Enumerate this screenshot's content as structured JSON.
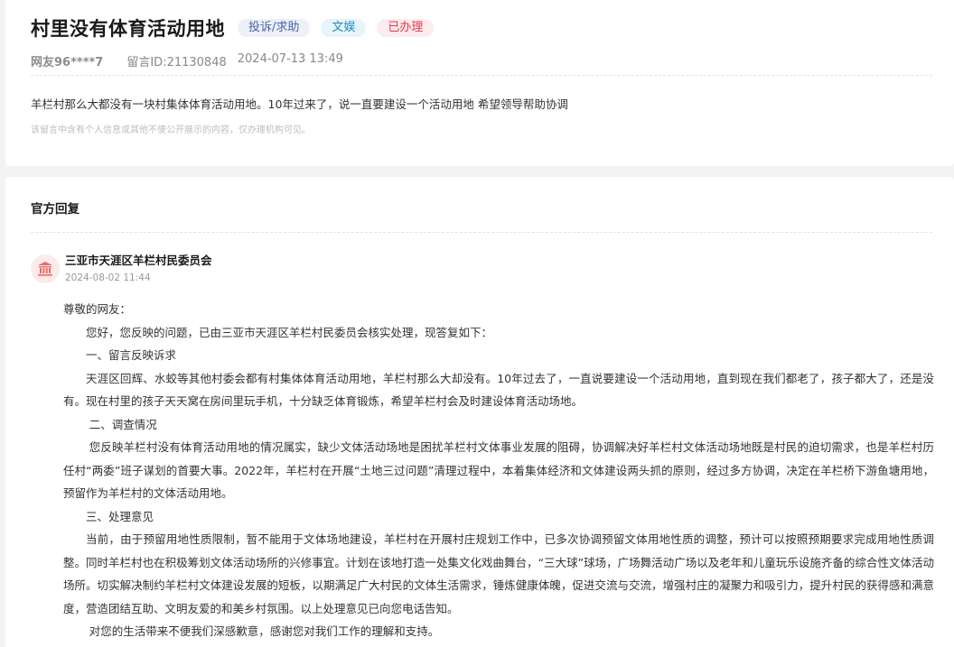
{
  "post": {
    "title": "村里没有体育活动用地",
    "tags": {
      "category": "投诉/求助",
      "area": "文娱",
      "status": "已办理"
    },
    "author": "网友96****7",
    "message_id": "留言ID:21130848",
    "datetime": "2024-07-13 13:49",
    "content": "羊栏村那么大都没有一块村集体体育活动用地。10年过来了，说一直要建设一个活动用地 希望领导帮助协调",
    "privacy_notice": "该留言中含有个人信息或其他不便公开展示的内容，仅办理机构可见。"
  },
  "reply": {
    "section_title": "官方回复",
    "org_name": "三亚市天涯区羊栏村民委员会",
    "org_time": "2024-08-02 11:44",
    "paragraphs": {
      "greeting": "尊敬的网友：",
      "intro": "您好，您反映的问题，已由三亚市天涯区羊栏村民委员会核实处理，现答复如下：",
      "h1": "一、留言反映诉求",
      "p1": "天涯区回辉、水蛟等其他村委会都有村集体体育活动用地，羊栏村那么大却没有。10年过去了，一直说要建设一个活动用地，直到现在我们都老了，孩子都大了，还是没有。现在村里的孩子天天窝在房间里玩手机，十分缺乏体育锻炼，希望羊栏村会及时建设体育活动场地。",
      "h2": "二、调查情况",
      "p2": "您反映羊栏村没有体育活动用地的情况属实，缺少文体活动场地是困扰羊栏村文体事业发展的阻碍，协调解决好羊栏村文体活动场地既是村民的迫切需求，也是羊栏村历任村“两委”班子谋划的首要大事。2022年，羊栏村在开展“土地三过问题”清理过程中，本着集体经济和文体建设两头抓的原则，经过多方协调，决定在羊栏桥下游鱼塘用地，预留作为羊栏村的文体活动用地。",
      "h3": "三、处理意见",
      "p3": "当前，由于预留用地性质限制，暂不能用于文体场地建设，羊栏村在开展村庄规划工作中，已多次协调预留文体用地性质的调整，预计可以按照预期要求完成用地性质调整。同时羊栏村也在积极筹划文体活动场所的兴修事宜。计划在该地打造一处集文化戏曲舞台，“三大球”球场，广场舞活动广场以及老年和儿童玩乐设施齐备的综合性文体活动场所。切实解决制约羊栏村文体建设发展的短板，以期满足广大村民的文体生活需求，锤炼健康体魄，促进交流与交流，增强村庄的凝聚力和吸引力，提升村民的获得感和满意度，营造团结互助、文明友爱的和美乡村氛围。以上处理意见已向您电话告知。",
      "closing": "对您的生活带来不便我们深感歉意，感谢您对我们工作的理解和支持。"
    }
  },
  "colors": {
    "status_red": "#e0394a",
    "category_blue": "#4a63a6",
    "area_cyan": "#1f8bbd",
    "org_icon": "#e86a6a"
  },
  "icons": {
    "org": "government-building-icon"
  }
}
